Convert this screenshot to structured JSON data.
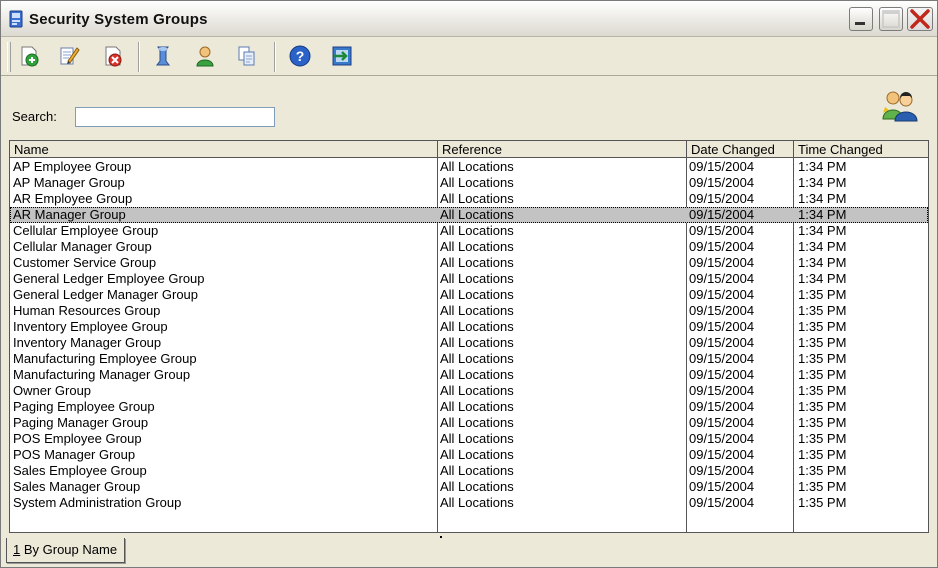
{
  "window": {
    "title": "Security System Groups"
  },
  "toolbar": {
    "items": [
      {
        "icon": "add-icon"
      },
      {
        "icon": "edit-icon"
      },
      {
        "icon": "delete-icon"
      },
      {
        "icon": "security-icon"
      },
      {
        "icon": "user-icon"
      },
      {
        "icon": "copy-icon"
      },
      {
        "icon": "help-icon"
      },
      {
        "icon": "exit-icon"
      }
    ]
  },
  "search": {
    "label": "Search:",
    "value": "",
    "placeholder": ""
  },
  "table": {
    "columns": [
      "Name",
      "Reference",
      "Date Changed",
      "Time Changed"
    ],
    "selected_row": 3,
    "rows": [
      [
        "AP Employee Group",
        "All Locations",
        "09/15/2004",
        "1:34 PM"
      ],
      [
        "AP Manager Group",
        "All Locations",
        "09/15/2004",
        "1:34 PM"
      ],
      [
        "AR Employee Group",
        "All Locations",
        "09/15/2004",
        "1:34 PM"
      ],
      [
        "AR Manager Group",
        "All Locations",
        "09/15/2004",
        "1:34 PM"
      ],
      [
        "Cellular Employee Group",
        "All Locations",
        "09/15/2004",
        "1:34 PM"
      ],
      [
        "Cellular Manager Group",
        "All Locations",
        "09/15/2004",
        "1:34 PM"
      ],
      [
        "Customer Service Group",
        "All Locations",
        "09/15/2004",
        "1:34 PM"
      ],
      [
        "General Ledger Employee Group",
        "All Locations",
        "09/15/2004",
        "1:34 PM"
      ],
      [
        "General Ledger Manager Group",
        "All Locations",
        "09/15/2004",
        "1:35 PM"
      ],
      [
        "Human Resources Group",
        "All Locations",
        "09/15/2004",
        "1:35 PM"
      ],
      [
        "Inventory Employee Group",
        "All Locations",
        "09/15/2004",
        "1:35 PM"
      ],
      [
        "Inventory Manager Group",
        "All Locations",
        "09/15/2004",
        "1:35 PM"
      ],
      [
        "Manufacturing Employee Group",
        "All Locations",
        "09/15/2004",
        "1:35 PM"
      ],
      [
        "Manufacturing Manager Group",
        "All Locations",
        "09/15/2004",
        "1:35 PM"
      ],
      [
        "Owner Group",
        "All Locations",
        "09/15/2004",
        "1:35 PM"
      ],
      [
        "Paging Employee Group",
        "All Locations",
        "09/15/2004",
        "1:35 PM"
      ],
      [
        "Paging Manager Group",
        "All Locations",
        "09/15/2004",
        "1:35 PM"
      ],
      [
        "POS Employee Group",
        "All Locations",
        "09/15/2004",
        "1:35 PM"
      ],
      [
        "POS Manager Group",
        "All Locations",
        "09/15/2004",
        "1:35 PM"
      ],
      [
        "Sales Employee Group",
        "All Locations",
        "09/15/2004",
        "1:35 PM"
      ],
      [
        "Sales Manager Group",
        "All Locations",
        "09/15/2004",
        "1:35 PM"
      ],
      [
        "System Administration Group",
        "All Locations",
        "09/15/2004",
        "1:35 PM"
      ]
    ]
  },
  "tabs": [
    {
      "hotkey": "1",
      "label": " By Group Name"
    }
  ]
}
